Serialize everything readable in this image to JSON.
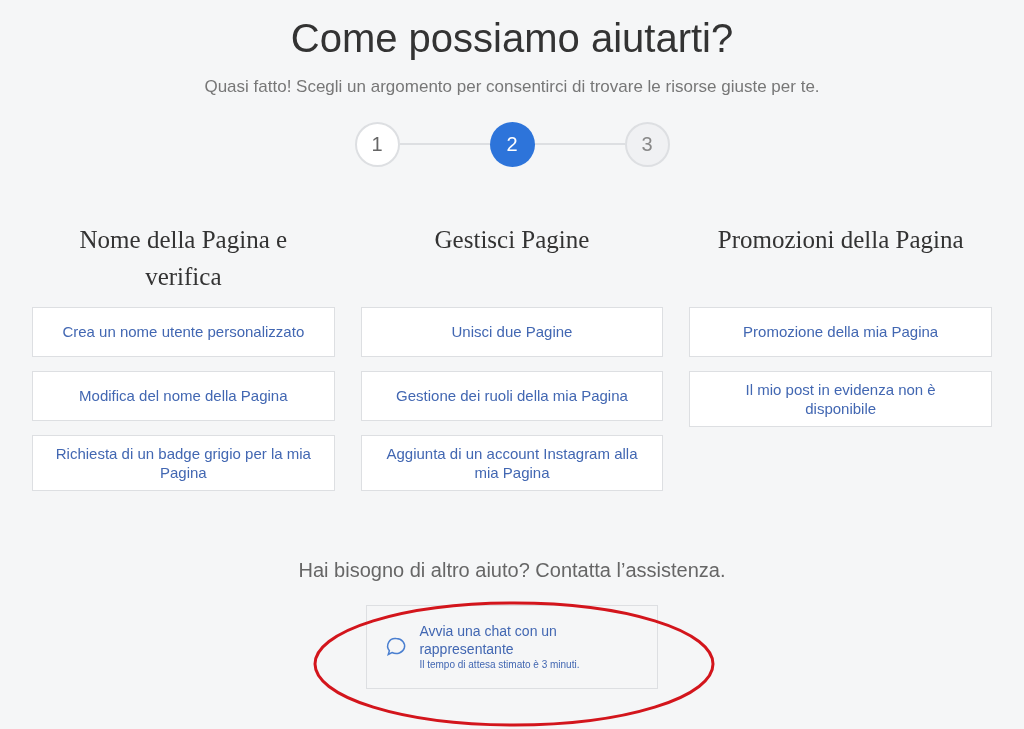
{
  "title": "Come possiamo aiutarti?",
  "subtitle": "Quasi fatto! Scegli un argomento per consentirci di trovare le risorse giuste per te.",
  "steps": [
    {
      "label": "1",
      "selected": false,
      "completed": true
    },
    {
      "label": "2",
      "selected": true,
      "completed": false
    },
    {
      "label": "3",
      "selected": false,
      "completed": false
    }
  ],
  "columns": [
    {
      "heading": "Nome della Pagina e verifica",
      "topics": [
        "Crea un nome utente personalizzato",
        "Modifica del nome della Pagina",
        "Richiesta di un badge grigio per la mia Pagina"
      ]
    },
    {
      "heading": "Gestisci Pagine",
      "topics": [
        "Unisci due Pagine",
        "Gestione dei ruoli della mia Pagina",
        "Aggiunta di un account Instagram alla mia Pagina"
      ]
    },
    {
      "heading": "Promozioni della Pagina",
      "topics": [
        "Promozione della mia Pagina",
        "Il mio post in evidenza non è disponibile"
      ]
    }
  ],
  "help_text": "Hai bisogno di altro aiuto? Contatta l’assistenza.",
  "chat": {
    "title": "Avvia una chat con un rappresentante",
    "note": "Il tempo di attesa stimato è 3 minuti."
  }
}
